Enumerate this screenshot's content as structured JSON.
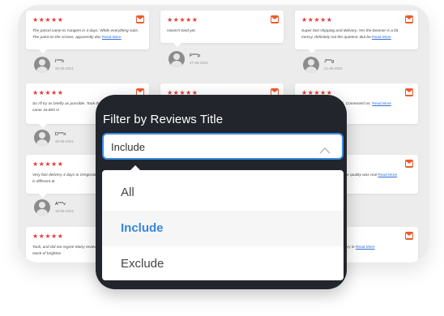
{
  "background_reviews": {
    "stars": "★★★★★",
    "read_more": "Read More",
    "cards": [
      {
        "text": "The parcel came to Yungem in 4 days. While everything suits. The paint on the screen, apparently doc"
      },
      {
        "text": "Haven't tried yet."
      },
      {
        "text": "Super fast shipping and delivery. Yes the beamer is a bit messy, definitely not the quietest. But be"
      },
      {
        "text": "So I'll try as briefly as possible. Took the version. With a bag came 16.800 st"
      },
      {
        "text": ""
      },
      {
        "text": "2 days before Starvtopol. Connected on."
      },
      {
        "text": "Very fast delivery 4 days to Oregostan projector MW8, from it is different at"
      },
      {
        "text": ""
      },
      {
        "text": "on my bright yellow wall the quality was real"
      },
      {
        "text": "Tooli, and did not regret! Many reviews take this model. The stock of brightne"
      },
      {
        "text": ""
      },
      {
        "text": "At the highest level! Delivery in"
      }
    ],
    "authors": [
      {
        "name": "I***h",
        "date": "20-05-2021"
      },
      {
        "name": "P***p",
        "date": "27-05-2021"
      },
      {
        "name": "J***g",
        "date": "21-05-2021"
      },
      {
        "name": "D***n",
        "date": "20-05-2021"
      },
      {
        "name": "A***v",
        "date": "18-05-2021"
      }
    ]
  },
  "filter": {
    "label": "Filter by Reviews Title",
    "selected": "Include",
    "options": [
      "All",
      "Include",
      "Exclude"
    ]
  },
  "colors": {
    "accent": "#3a8be8",
    "panel": "#22252b",
    "star": "#e23b3b",
    "badge": "#ee5a2a"
  }
}
